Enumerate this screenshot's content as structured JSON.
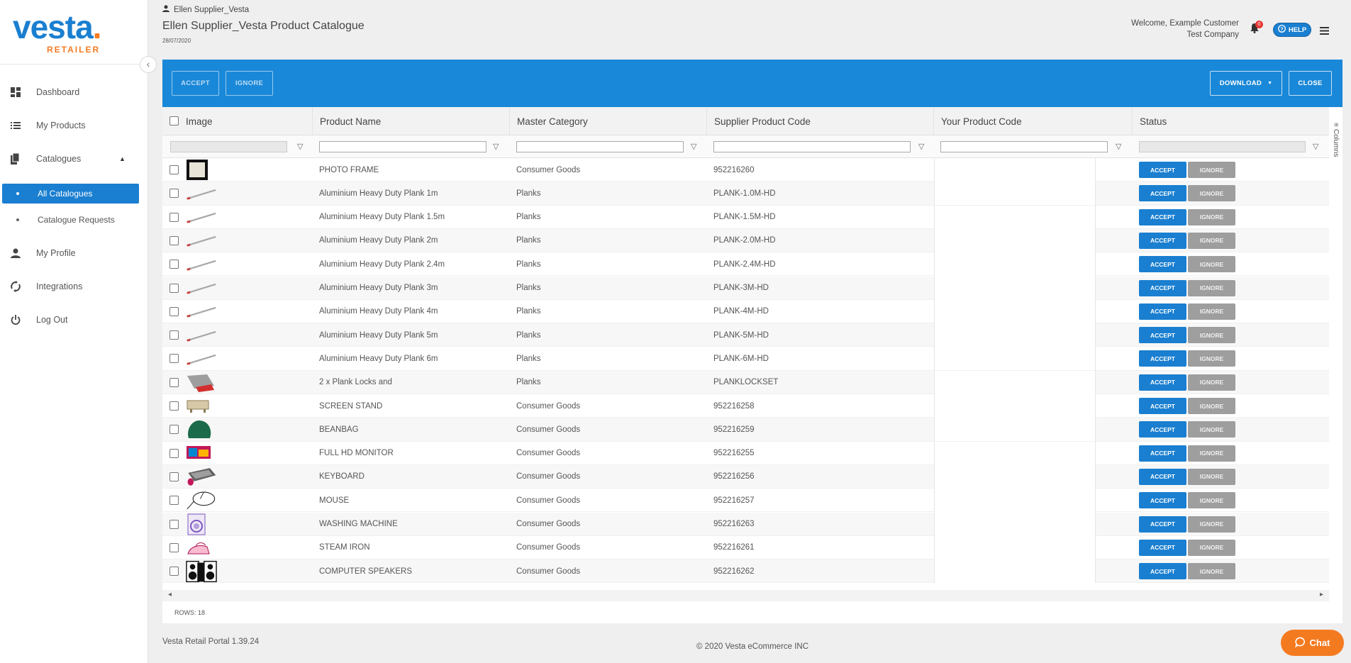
{
  "sidebar": {
    "logo_text": "vesta",
    "logo_sub": "RETAILER",
    "items": [
      {
        "label": "Dashboard",
        "icon": "dashboard-icon"
      },
      {
        "label": "My Products",
        "icon": "list-icon"
      },
      {
        "label": "Catalogues",
        "icon": "file-copy-icon"
      },
      {
        "label": "My Profile",
        "icon": "person-icon"
      },
      {
        "label": "Integrations",
        "icon": "sync-icon"
      },
      {
        "label": "Log Out",
        "icon": "power-icon"
      }
    ],
    "sub_items": [
      {
        "label": "All Catalogues",
        "active": true
      },
      {
        "label": "Catalogue Requests",
        "active": false
      }
    ]
  },
  "header": {
    "user": "Ellen Supplier_Vesta",
    "title": "Ellen Supplier_Vesta Product Catalogue",
    "date": "28/07/2020",
    "welcome": "Welcome, Example Customer",
    "company": "Test Company",
    "notif_count": "0",
    "help_label": "HELP"
  },
  "toolbar": {
    "accept": "ACCEPT",
    "ignore": "IGNORE",
    "download": "DOWNLOAD",
    "close": "CLOSE"
  },
  "grid": {
    "columns": [
      "Image",
      "Product Name",
      "Master Category",
      "Supplier Product Code",
      "Your Product Code",
      "Status"
    ],
    "columns_tab": "Columns",
    "row_accept": "ACCEPT",
    "row_ignore": "IGNORE",
    "rows_label": "ROWS: 18",
    "rows": [
      {
        "name": "PHOTO FRAME",
        "category": "Consumer Goods",
        "code": "952216260",
        "img": "photo-frame"
      },
      {
        "name": "Aluminium Heavy Duty Plank 1m",
        "category": "Planks",
        "code": "PLANK-1.0M-HD",
        "img": "plank"
      },
      {
        "name": "Aluminium Heavy Duty Plank 1.5m",
        "category": "Planks",
        "code": "PLANK-1.5M-HD",
        "img": "plank"
      },
      {
        "name": "Aluminium Heavy Duty Plank 2m",
        "category": "Planks",
        "code": "PLANK-2.0M-HD",
        "img": "plank"
      },
      {
        "name": "Aluminium Heavy Duty Plank 2.4m",
        "category": "Planks",
        "code": "PLANK-2.4M-HD",
        "img": "plank"
      },
      {
        "name": "Aluminium Heavy Duty Plank 3m",
        "category": "Planks",
        "code": "PLANK-3M-HD",
        "img": "plank"
      },
      {
        "name": "Aluminium Heavy Duty Plank 4m",
        "category": "Planks",
        "code": "PLANK-4M-HD",
        "img": "plank"
      },
      {
        "name": "Aluminium Heavy Duty Plank 5m",
        "category": "Planks",
        "code": "PLANK-5M-HD",
        "img": "plank"
      },
      {
        "name": "Aluminium Heavy Duty Plank 6m",
        "category": "Planks",
        "code": "PLANK-6M-HD",
        "img": "plank"
      },
      {
        "name": "2 x Plank Locks and",
        "category": "Planks",
        "code": "PLANKLOCKSET",
        "img": "plank-lock"
      },
      {
        "name": "SCREEN STAND",
        "category": "Consumer Goods",
        "code": "952216258",
        "img": "screen-stand"
      },
      {
        "name": "BEANBAG",
        "category": "Consumer Goods",
        "code": "952216259",
        "img": "beanbag"
      },
      {
        "name": "FULL HD MONITOR",
        "category": "Consumer Goods",
        "code": "952216255",
        "img": "monitor"
      },
      {
        "name": "KEYBOARD",
        "category": "Consumer Goods",
        "code": "952216256",
        "img": "keyboard"
      },
      {
        "name": "MOUSE",
        "category": "Consumer Goods",
        "code": "952216257",
        "img": "mouse"
      },
      {
        "name": "WASHING MACHINE",
        "category": "Consumer Goods",
        "code": "952216263",
        "img": "washing-machine"
      },
      {
        "name": "STEAM IRON",
        "category": "Consumer Goods",
        "code": "952216261",
        "img": "steam-iron"
      },
      {
        "name": "COMPUTER SPEAKERS",
        "category": "Consumer Goods",
        "code": "952216262",
        "img": "speakers"
      }
    ]
  },
  "footer": {
    "version": "Vesta Retail Portal 1.39.24",
    "copyright": "© 2020 Vesta eCommerce INC",
    "chat": "Chat"
  },
  "colors": {
    "brand_blue": "#1a7fd0",
    "brand_orange": "#f47a20",
    "toolbar_blue": "#1a88d8",
    "ignore_grey": "#9e9e9e"
  }
}
